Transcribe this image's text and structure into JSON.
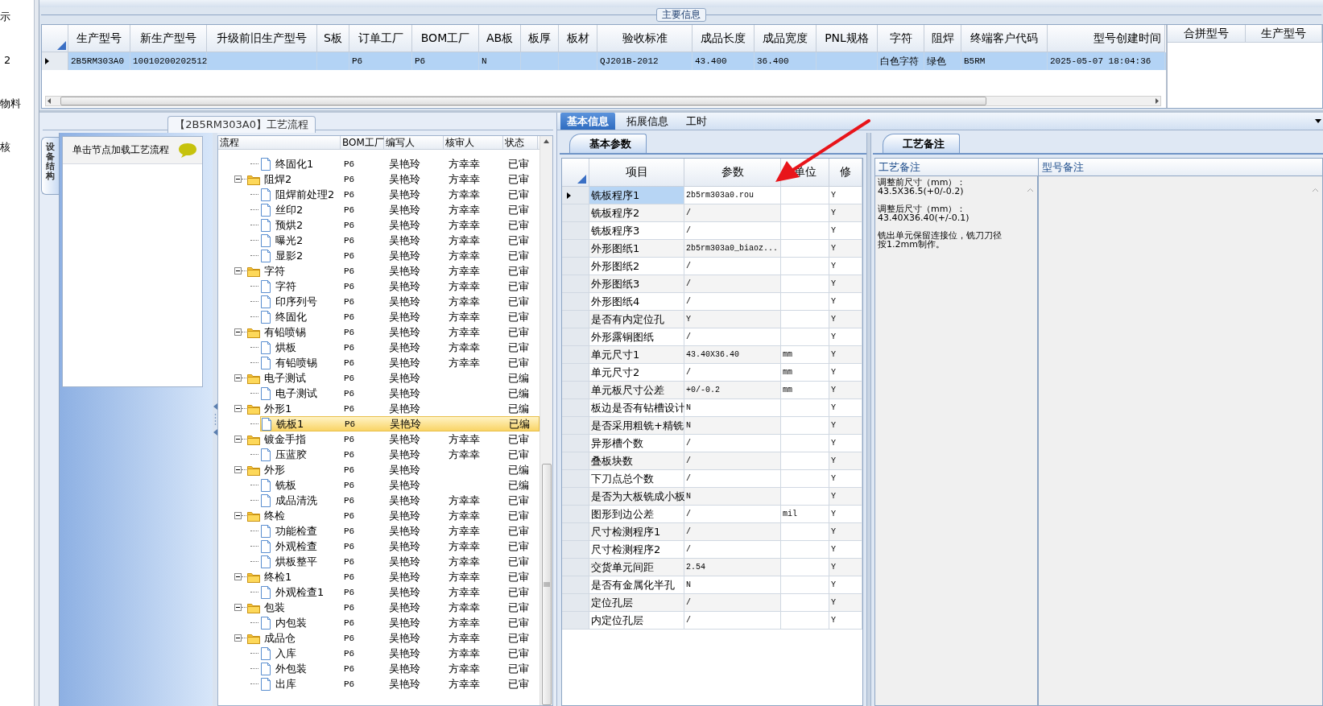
{
  "side_labels": [
    "示",
    "2",
    "物料",
    "核"
  ],
  "main_info": {
    "title": "主要信息",
    "row_selected": true,
    "columns": [
      {
        "header": "生产型号",
        "value": "2B5RM303A0"
      },
      {
        "header": "新生产型号",
        "value": "10010200202512"
      },
      {
        "header": "升级前旧生产型号"
      },
      {
        "header": "S板"
      },
      {
        "header": "订单工厂",
        "value": "P6"
      },
      {
        "header": "BOM工厂",
        "value": "P6"
      },
      {
        "header": "AB板",
        "value": "N"
      },
      {
        "header": "板厚"
      },
      {
        "header": "板材"
      },
      {
        "header": "验收标准",
        "value": "QJ201B-2012"
      },
      {
        "header": "成品长度",
        "value": "43.400"
      },
      {
        "header": "成品宽度",
        "value": "36.400"
      },
      {
        "header": "PNL规格"
      },
      {
        "header": "字符",
        "value": "白色字符"
      },
      {
        "header": "阻焊",
        "value": "绿色"
      },
      {
        "header": "终端客户代码",
        "value": "B5RM"
      },
      {
        "header": "型号创建时间",
        "value": "2025-05-07 18:04:36"
      }
    ],
    "merge_columns": [
      "合拼型号",
      "生产型号"
    ]
  },
  "process": {
    "title": "【2B5RM303A0】工艺流程",
    "side_tab": "设备结构",
    "hint": "单击节点加载工艺流程",
    "columns": [
      "流程",
      "BOM工厂",
      "编写人",
      "核审人",
      "状态"
    ],
    "tree": [
      {
        "kind": "step",
        "name": "终固化1",
        "bom": "P6",
        "writer": "吴艳玲",
        "reviewer": "方幸幸",
        "status": "已审",
        "selected": false
      },
      {
        "kind": "group",
        "name": "阻焊2",
        "bom": "P6",
        "writer": "吴艳玲",
        "reviewer": "方幸幸",
        "status": "已审",
        "selected": false,
        "expanded": true,
        "children": [
          {
            "kind": "step",
            "name": "阻焊前处理2",
            "bom": "P6",
            "writer": "吴艳玲",
            "reviewer": "方幸幸",
            "status": "已审",
            "selected": false
          },
          {
            "kind": "step",
            "name": "丝印2",
            "bom": "P6",
            "writer": "吴艳玲",
            "reviewer": "方幸幸",
            "status": "已审",
            "selected": false
          },
          {
            "kind": "step",
            "name": "预烘2",
            "bom": "P6",
            "writer": "吴艳玲",
            "reviewer": "方幸幸",
            "status": "已审",
            "selected": false
          },
          {
            "kind": "step",
            "name": "曝光2",
            "bom": "P6",
            "writer": "吴艳玲",
            "reviewer": "方幸幸",
            "status": "已审",
            "selected": false
          },
          {
            "kind": "step",
            "name": "显影2",
            "bom": "P6",
            "writer": "吴艳玲",
            "reviewer": "方幸幸",
            "status": "已审",
            "selected": false
          }
        ]
      },
      {
        "kind": "group",
        "name": "字符",
        "bom": "P6",
        "writer": "吴艳玲",
        "reviewer": "方幸幸",
        "status": "已审",
        "selected": false,
        "expanded": true,
        "children": [
          {
            "kind": "step",
            "name": "字符",
            "bom": "P6",
            "writer": "吴艳玲",
            "reviewer": "方幸幸",
            "status": "已审",
            "selected": false
          },
          {
            "kind": "step",
            "name": "印序列号",
            "bom": "P6",
            "writer": "吴艳玲",
            "reviewer": "方幸幸",
            "status": "已审",
            "selected": false
          },
          {
            "kind": "step",
            "name": "终固化",
            "bom": "P6",
            "writer": "吴艳玲",
            "reviewer": "方幸幸",
            "status": "已审",
            "selected": false
          }
        ]
      },
      {
        "kind": "group",
        "name": "有铅喷锡",
        "bom": "P6",
        "writer": "吴艳玲",
        "reviewer": "方幸幸",
        "status": "已审",
        "selected": false,
        "expanded": true,
        "children": [
          {
            "kind": "step",
            "name": "烘板",
            "bom": "P6",
            "writer": "吴艳玲",
            "reviewer": "方幸幸",
            "status": "已审",
            "selected": false
          },
          {
            "kind": "step",
            "name": "有铅喷锡",
            "bom": "P6",
            "writer": "吴艳玲",
            "reviewer": "方幸幸",
            "status": "已审",
            "selected": false
          }
        ]
      },
      {
        "kind": "group",
        "name": "电子测试",
        "bom": "P6",
        "writer": "吴艳玲",
        "status": "已编",
        "selected": false,
        "expanded": true,
        "children": [
          {
            "kind": "step",
            "name": "电子测试",
            "bom": "P6",
            "writer": "吴艳玲",
            "status": "已编",
            "selected": false
          }
        ]
      },
      {
        "kind": "group",
        "name": "外形1",
        "bom": "P6",
        "writer": "吴艳玲",
        "status": "已编",
        "selected": false,
        "expanded": true,
        "children": [
          {
            "kind": "step",
            "name": "铣板1",
            "bom": "P6",
            "writer": "吴艳玲",
            "status": "已编",
            "selected": true
          }
        ]
      },
      {
        "kind": "group",
        "name": "镀金手指",
        "bom": "P6",
        "writer": "吴艳玲",
        "reviewer": "方幸幸",
        "status": "已审",
        "selected": false,
        "expanded": true,
        "children": [
          {
            "kind": "step",
            "name": "压蓝胶",
            "bom": "P6",
            "writer": "吴艳玲",
            "reviewer": "方幸幸",
            "status": "已审",
            "selected": false
          }
        ]
      },
      {
        "kind": "group",
        "name": "外形",
        "bom": "P6",
        "writer": "吴艳玲",
        "status": "已编",
        "selected": false,
        "expanded": true,
        "children": [
          {
            "kind": "step",
            "name": "铣板",
            "bom": "P6",
            "writer": "吴艳玲",
            "status": "已编",
            "selected": false
          },
          {
            "kind": "step",
            "name": "成品清洗",
            "bom": "P6",
            "writer": "吴艳玲",
            "reviewer": "方幸幸",
            "status": "已审",
            "selected": false
          }
        ]
      },
      {
        "kind": "group",
        "name": "终检",
        "bom": "P6",
        "writer": "吴艳玲",
        "reviewer": "方幸幸",
        "status": "已审",
        "selected": false,
        "expanded": true,
        "children": [
          {
            "kind": "step",
            "name": "功能检查",
            "bom": "P6",
            "writer": "吴艳玲",
            "reviewer": "方幸幸",
            "status": "已审",
            "selected": false
          },
          {
            "kind": "step",
            "name": "外观检查",
            "bom": "P6",
            "writer": "吴艳玲",
            "reviewer": "方幸幸",
            "status": "已审",
            "selected": false
          },
          {
            "kind": "step",
            "name": "烘板整平",
            "bom": "P6",
            "writer": "吴艳玲",
            "reviewer": "方幸幸",
            "status": "已审",
            "selected": false
          }
        ]
      },
      {
        "kind": "group",
        "name": "终检1",
        "bom": "P6",
        "writer": "吴艳玲",
        "reviewer": "方幸幸",
        "status": "已审",
        "selected": false,
        "expanded": true,
        "children": [
          {
            "kind": "step",
            "name": "外观检查1",
            "bom": "P6",
            "writer": "吴艳玲",
            "reviewer": "方幸幸",
            "status": "已审",
            "selected": false
          }
        ]
      },
      {
        "kind": "group",
        "name": "包装",
        "bom": "P6",
        "writer": "吴艳玲",
        "reviewer": "方幸幸",
        "status": "已审",
        "selected": false,
        "expanded": true,
        "children": [
          {
            "kind": "step",
            "name": "内包装",
            "bom": "P6",
            "writer": "吴艳玲",
            "reviewer": "方幸幸",
            "status": "已审",
            "selected": false
          }
        ]
      },
      {
        "kind": "group",
        "name": "成品仓",
        "bom": "P6",
        "writer": "吴艳玲",
        "reviewer": "方幸幸",
        "status": "已审",
        "selected": false,
        "expanded": true,
        "children": [
          {
            "kind": "step",
            "name": "入库",
            "bom": "P6",
            "writer": "吴艳玲",
            "reviewer": "方幸幸",
            "status": "已审",
            "selected": false
          },
          {
            "kind": "step",
            "name": "外包装",
            "bom": "P6",
            "writer": "吴艳玲",
            "reviewer": "方幸幸",
            "status": "已审",
            "selected": false
          },
          {
            "kind": "step",
            "name": "出库",
            "bom": "P6",
            "writer": "吴艳玲",
            "reviewer": "方幸幸",
            "status": "已审",
            "selected": false
          }
        ]
      }
    ]
  },
  "detail": {
    "tabs": [
      {
        "label": "基本信息",
        "selected": true
      },
      {
        "label": "拓展信息",
        "selected": false
      },
      {
        "label": "工时",
        "selected": false
      }
    ],
    "params": {
      "tab": "基本参数",
      "columns": [
        "项目",
        "参数",
        "单位",
        "修"
      ],
      "rows": [
        {
          "item": "铣板程序1",
          "value": "2b5rm303a0.rou",
          "modified": "Y",
          "selected": true
        },
        {
          "item": "铣板程序2",
          "value": "/",
          "modified": "Y",
          "selected": false
        },
        {
          "item": "铣板程序3",
          "value": "/",
          "modified": "Y",
          "selected": false
        },
        {
          "item": "外形图纸1",
          "value": "2b5rm303a0_biaoz...",
          "modified": "Y",
          "selected": false
        },
        {
          "item": "外形图纸2",
          "value": "/",
          "modified": "Y",
          "selected": false
        },
        {
          "item": "外形图纸3",
          "value": "/",
          "modified": "Y",
          "selected": false
        },
        {
          "item": "外形图纸4",
          "value": "/",
          "modified": "Y",
          "selected": false
        },
        {
          "item": "是否有内定位孔",
          "value": "Y",
          "modified": "Y",
          "selected": false
        },
        {
          "item": "外形露铜图纸",
          "value": "/",
          "modified": "Y",
          "selected": false
        },
        {
          "item": "单元尺寸1",
          "value": "43.40X36.40",
          "unit": "mm",
          "modified": "Y",
          "selected": false
        },
        {
          "item": "单元尺寸2",
          "value": "/",
          "unit": "mm",
          "modified": "Y",
          "selected": false
        },
        {
          "item": "单元板尺寸公差",
          "value": "+0/-0.2",
          "unit": "mm",
          "modified": "Y",
          "selected": false
        },
        {
          "item": "板边是否有钻槽设计",
          "value": "N",
          "modified": "Y",
          "selected": false
        },
        {
          "item": "是否采用粗铣+精铣",
          "value": "N",
          "modified": "Y",
          "selected": false
        },
        {
          "item": "异形槽个数",
          "value": "/",
          "modified": "Y",
          "selected": false
        },
        {
          "item": "叠板块数",
          "value": "/",
          "modified": "Y",
          "selected": false
        },
        {
          "item": "下刀点总个数",
          "value": "/",
          "modified": "Y",
          "selected": false
        },
        {
          "item": "是否为大板铣成小板",
          "value": "N",
          "modified": "Y",
          "selected": false
        },
        {
          "item": "图形到边公差",
          "value": "/",
          "unit": "mil",
          "modified": "Y",
          "selected": false
        },
        {
          "item": "尺寸检测程序1",
          "value": "/",
          "modified": "Y",
          "selected": false
        },
        {
          "item": "尺寸检测程序2",
          "value": "/",
          "modified": "Y",
          "selected": false
        },
        {
          "item": "交货单元间距",
          "value": "2.54",
          "modified": "Y",
          "selected": false
        },
        {
          "item": "是否有金属化半孔",
          "value": "N",
          "modified": "Y",
          "selected": false
        },
        {
          "item": "定位孔层",
          "value": "/",
          "modified": "Y",
          "selected": false
        },
        {
          "item": "内定位孔层",
          "value": "/",
          "modified": "Y",
          "selected": false
        }
      ]
    },
    "notes": {
      "tab": "工艺备注",
      "columns": [
        "工艺备注",
        "型号备注"
      ],
      "process_note": "调整前尺寸（mm）：\n43.5X36.5(+0/-0.2)\n\n调整后尺寸（mm）：\n43.40X36.40(+/-0.1)\n\n铣出单元保留连接位，铣刀刀径按1.2mm制作。"
    }
  }
}
